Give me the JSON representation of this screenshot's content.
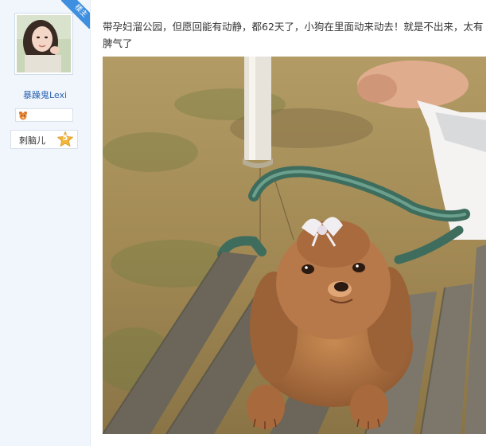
{
  "author": {
    "name": "暴躁鬼Lexi",
    "role_badge": "楼主",
    "level_name": "刺脑儿",
    "level_number": "5"
  },
  "post": {
    "text": "带孕妇溜公园，但愿回能有动静，都62天了，小狗在里面动来动去！就是不出来，太有脾气了"
  },
  "icons": {
    "medal": "bear-medal-icon",
    "level": "level-star-badge-icon"
  },
  "colors": {
    "sidebar_bg": "#f1f6fc",
    "username": "#2d64b3",
    "ribbon": "#3e8fe0",
    "level_badge": "#f2b63a"
  }
}
